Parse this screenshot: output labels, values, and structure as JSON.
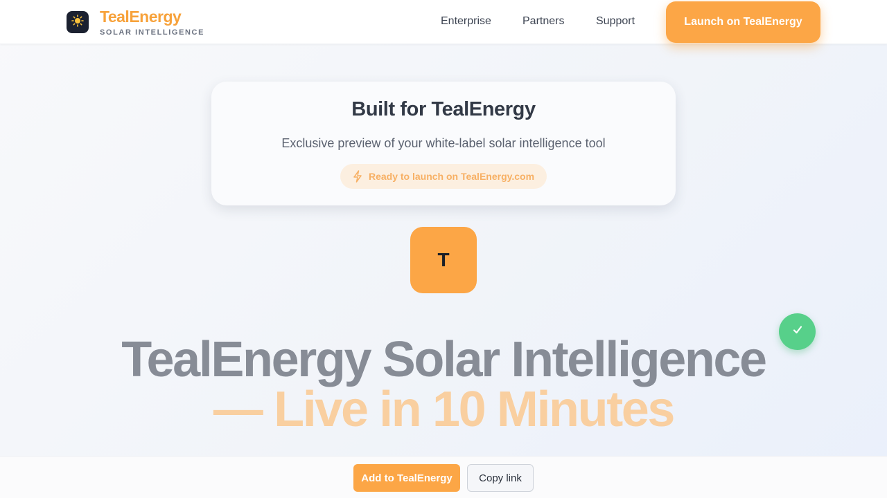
{
  "header": {
    "brand_name": "TealEnergy",
    "brand_subtitle": "SOLAR INTELLIGENCE",
    "logo_icon": "sun-icon",
    "nav": {
      "enterprise": "Enterprise",
      "partners": "Partners",
      "support": "Support"
    },
    "cta_label": "Launch on TealEnergy"
  },
  "card": {
    "title": "Built for TealEnergy",
    "description": "Exclusive preview of your white-label solar intelligence tool",
    "pill_icon": "lightning-icon",
    "pill_text": "Ready to launch on TealEnergy.com"
  },
  "avatar": {
    "initial": "T"
  },
  "badge": {
    "icon": "check-icon"
  },
  "hero": {
    "line1": "TealEnergy Solar Intelligence",
    "line2": "— Live in 10 Minutes"
  },
  "footer": {
    "add_label": "Add to TealEnergy",
    "copy_label": "Copy link"
  },
  "colors": {
    "accent": "#fca646",
    "brand_text": "#f7a23b",
    "success": "#57d08a",
    "dark": "#1b2130"
  }
}
